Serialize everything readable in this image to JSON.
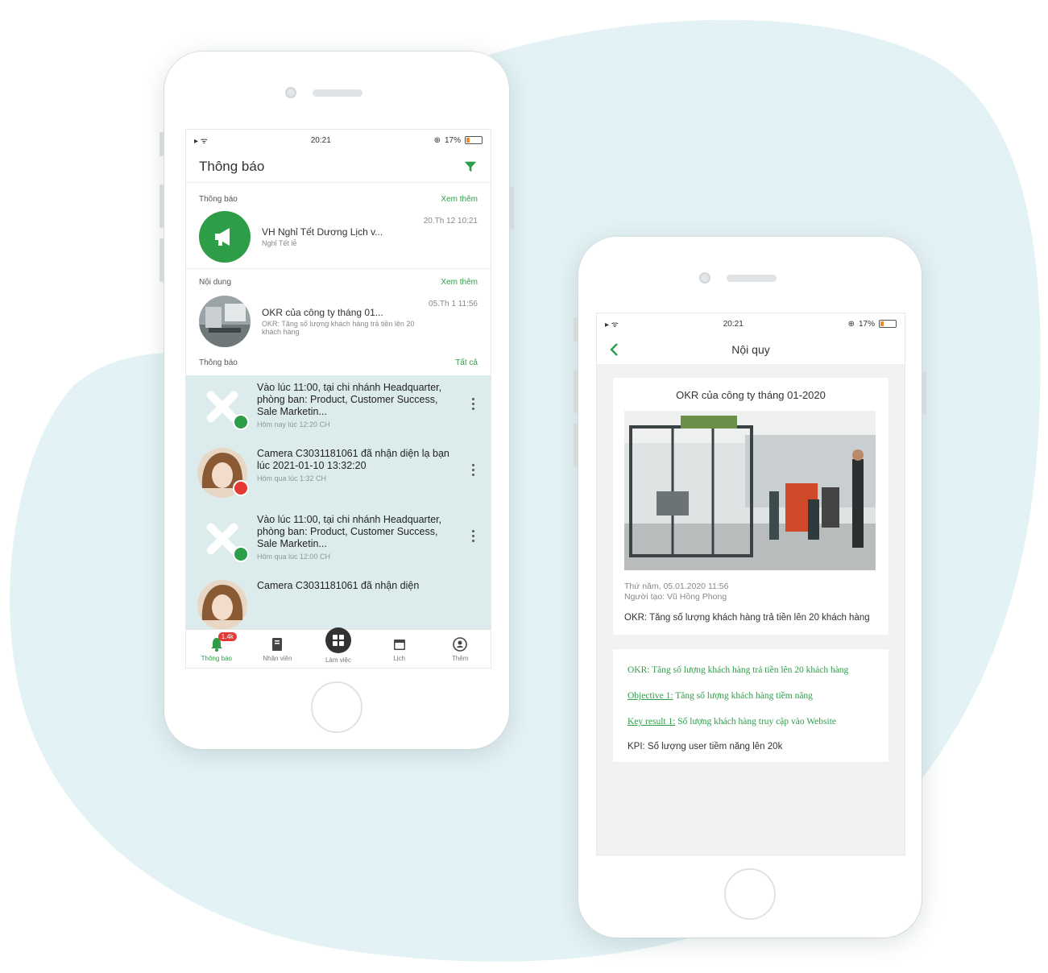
{
  "phone1": {
    "status": {
      "time": "20:21",
      "battery": "17%"
    },
    "header": {
      "title": "Thông báo",
      "filter_icon": "filter-icon"
    },
    "sections": {
      "announcement": {
        "label": "Thông báo",
        "link": "Xem thêm"
      },
      "content": {
        "label": "Nội dung",
        "link": "Xem thêm"
      },
      "notifications": {
        "label": "Thông báo",
        "link": "Tất cả"
      }
    },
    "announcement_item": {
      "title": "VH Nghỉ Tết Dương Lịch v...",
      "sub": "Nghỉ Tết lễ",
      "time": "20.Th 12 10:21"
    },
    "content_item": {
      "title": "OKR của công ty tháng 01...",
      "sub": "OKR: Tăng số lượng khách hàng trả tiền lên 20 khách hàng",
      "time": "05.Th 1 11:56"
    },
    "notifications": [
      {
        "text": "Vào lúc 11:00, tại chi nhánh Headquarter, phòng ban: Product, Customer Success, Sale Marketin...",
        "sub": "Hôm nay lúc 12:20 CH",
        "kind": "tools"
      },
      {
        "text": "Camera C3031181061 đã nhận diện lạ bạn lúc 2021-01-10 13:32:20",
        "sub": "Hôm qua lúc 1:32 CH",
        "kind": "person"
      },
      {
        "text": "Vào lúc 11:00, tại chi nhánh Headquarter, phòng ban: Product, Customer Success, Sale Marketin...",
        "sub": "Hôm qua lúc 12:00 CH",
        "kind": "tools"
      },
      {
        "text": "Camera C3031181061 đã nhận diện",
        "sub": "",
        "kind": "person"
      }
    ],
    "tabs": [
      {
        "label": "Thông báo",
        "icon": "bell-icon",
        "badge": "1.4k"
      },
      {
        "label": "Nhân viên",
        "icon": "book-icon"
      },
      {
        "label": "Làm việc",
        "icon": "grid-icon"
      },
      {
        "label": "Lịch",
        "icon": "calendar-icon"
      },
      {
        "label": "Thêm",
        "icon": "user-icon"
      }
    ]
  },
  "phone2": {
    "status": {
      "time": "20:21",
      "battery": "17%"
    },
    "header": {
      "title": "Nội quy"
    },
    "card": {
      "title": "OKR của công ty tháng 01-2020",
      "date": "Thứ năm, 05.01.2020 11:56",
      "author": "Người tạo: Vũ Hồng Phong",
      "desc": "OKR: Tăng số lượng khách hàng trả tiền lên 20 khách hàng"
    },
    "detail": {
      "okr": "OKR: Tăng số lượng khách hàng trả tiền lên 20 khách hàng",
      "objective_label": "Objective 1:",
      "objective": " Tăng số lượng khách hàng tiềm năng",
      "kr_label": "Key result 1:",
      "kr": " Số lượng khách hàng truy cập vào Website",
      "kpi": "KPI: Số lượng user tiềm năng lên 20k"
    }
  },
  "colors": {
    "brand_green": "#2e9d48",
    "blob": "#e3f2f4",
    "highlight": "#dcecec",
    "badge_red": "#e53935"
  }
}
